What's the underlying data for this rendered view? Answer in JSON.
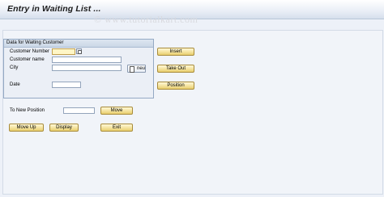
{
  "window": {
    "title": "Entry in Waiting List ...",
    "watermark": "© www.tutorialkart.com"
  },
  "group": {
    "title": "Data for Waiting Customer",
    "fields": {
      "customer_number": {
        "label": "Customer Number",
        "value": ""
      },
      "customer_name": {
        "label": "Customer name",
        "value": ""
      },
      "city": {
        "label": "City",
        "value": ""
      },
      "date": {
        "label": "Date",
        "value": ""
      }
    },
    "neu_button": {
      "label": "neu",
      "icon": "new-document-icon"
    },
    "f4_help": {
      "icon": "value-help-icon"
    }
  },
  "side_buttons": {
    "insert": "Insert",
    "take_out": "Take Out",
    "position": "Position"
  },
  "new_position": {
    "label": "To New Position",
    "value": "",
    "move_button": "Move"
  },
  "bottom_buttons": {
    "move_up": "Move Up",
    "display": "Display",
    "exit": "Exit"
  },
  "colors": {
    "button_fill": "#f4e39d",
    "required_field": "#fff6c6",
    "group_border": "#94a9c4"
  }
}
